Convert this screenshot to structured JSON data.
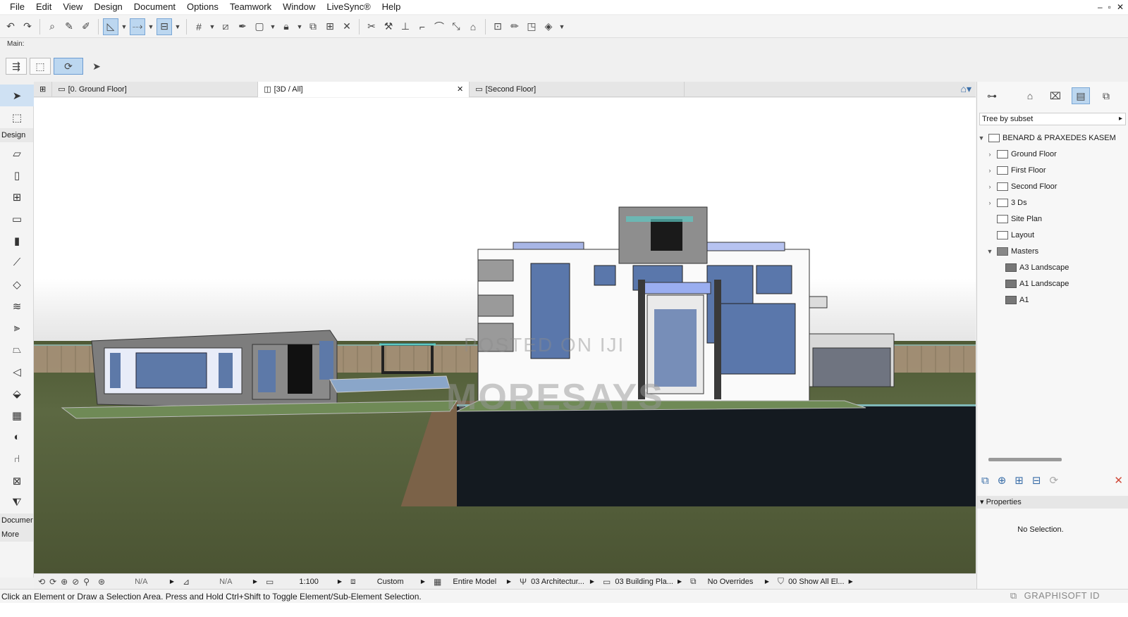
{
  "menu": [
    "File",
    "Edit",
    "View",
    "Design",
    "Document",
    "Options",
    "Teamwork",
    "Window",
    "LiveSync®",
    "Help"
  ],
  "window_controls": [
    "–",
    "▫",
    "✕"
  ],
  "toolbar": {
    "main_label": "Main:"
  },
  "toolbox": {
    "group_design": "Design",
    "group_document": "Documer",
    "group_more": "More"
  },
  "tabs": [
    {
      "label": "[0. Ground Floor]",
      "icon": "floor-plan-icon"
    },
    {
      "label": "[3D / All]",
      "icon": "3d-window-icon",
      "close": "✕"
    },
    {
      "label": "[Second Floor]",
      "icon": "floor-plan-icon"
    }
  ],
  "watermark": {
    "line1": "POSTED ON IJI",
    "line2": "MORESAYS"
  },
  "navigator": {
    "subset_label": "Tree by subset",
    "root": "BENARD & PRAXEDES KASEM",
    "items": [
      "Ground Floor",
      "First Floor",
      "Second Floor",
      "3 Ds",
      "Site Plan",
      "Layout",
      "Masters"
    ],
    "masters": [
      "A3 Landscape",
      "A1 Landscape",
      "A1"
    ]
  },
  "properties": {
    "header": "Properties",
    "empty": "No Selection."
  },
  "quick_options": {
    "zoom_val1": "N/A",
    "zoom_val2": "N/A",
    "scale": "1:100",
    "penset": "Custom",
    "model_view": "Entire Model",
    "layer_combo": "03 Architectur...",
    "dimension": "03 Building Pla...",
    "overrides": "No Overrides",
    "renovation": "00 Show All El..."
  },
  "status_text": "Click an Element or Draw a Selection Area. Press and Hold Ctrl+Shift to Toggle Element/Sub-Element Selection.",
  "brand": "GRAPHISOFT ID"
}
